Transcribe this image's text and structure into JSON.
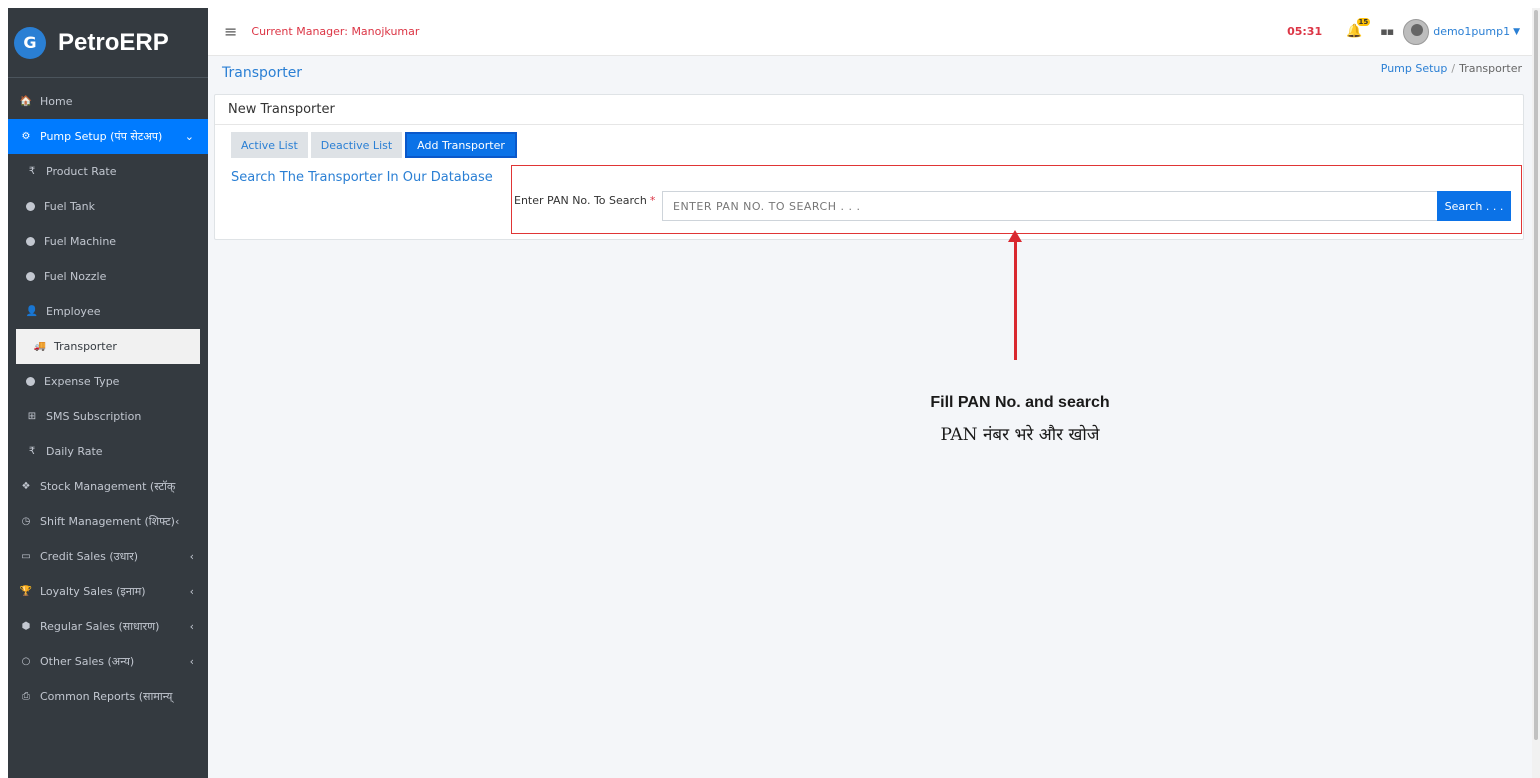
{
  "brand": {
    "name": "PetroERP",
    "logo_letter": "G"
  },
  "sidebar": {
    "items": [
      {
        "icon": "home-icon",
        "glyph": "🏠",
        "label": "Home",
        "type": "main"
      },
      {
        "icon": "cogs-icon",
        "glyph": "⚙",
        "label": "Pump Setup (पंप सेटअप)",
        "type": "main-active",
        "chevron": "⌄"
      },
      {
        "icon": "rupee-icon",
        "glyph": "₹",
        "label": "Product Rate",
        "type": "sub"
      },
      {
        "icon": "circle-icon",
        "label": "Fuel Tank",
        "type": "sub-dot"
      },
      {
        "icon": "circle-icon",
        "label": "Fuel Machine",
        "type": "sub-dot"
      },
      {
        "icon": "circle-icon",
        "label": "Fuel Nozzle",
        "type": "sub-dot"
      },
      {
        "icon": "user-icon",
        "glyph": "👤",
        "label": "Employee",
        "type": "sub"
      },
      {
        "icon": "truck-icon",
        "glyph": "🚚",
        "label": "Transporter",
        "type": "sub-active"
      },
      {
        "icon": "circle-icon",
        "label": "Expense Type",
        "type": "sub-dot"
      },
      {
        "icon": "plus-square-icon",
        "glyph": "⊞",
        "label": "SMS Subscription",
        "type": "sub"
      },
      {
        "icon": "rupee-icon",
        "glyph": "₹",
        "label": "Daily Rate",
        "type": "sub"
      },
      {
        "icon": "cubes-icon",
        "glyph": "❖",
        "label": "Stock Management (स्टॉक्",
        "type": "main"
      },
      {
        "icon": "clock-icon",
        "glyph": "◷",
        "label": "Shift Management (शिफ्ट)‹",
        "type": "main"
      },
      {
        "icon": "credit-card-icon",
        "glyph": "▭",
        "label": "Credit Sales (उधार)",
        "type": "main",
        "chevron": "‹"
      },
      {
        "icon": "trophy-icon",
        "glyph": "🏆",
        "label": "Loyalty Sales (इनाम)",
        "type": "main",
        "chevron": "‹"
      },
      {
        "icon": "cube-icon",
        "glyph": "⬢",
        "label": "Regular Sales (साधारण)",
        "type": "main",
        "chevron": "‹"
      },
      {
        "icon": "circle-outline-icon",
        "glyph": "○",
        "label": "Other Sales (अन्य)",
        "type": "main",
        "chevron": "‹"
      },
      {
        "icon": "print-icon",
        "glyph": "⎙",
        "label": "Common Reports (सामान्य्",
        "type": "main"
      }
    ]
  },
  "topbar": {
    "menu_icon": "≡",
    "manager": "Current Manager: Manojkumar",
    "clock": "05:31",
    "notification_count": "15",
    "username": "demo1pump1"
  },
  "page": {
    "title": "Transporter",
    "breadcrumb": {
      "parent": "Pump Setup",
      "separator": "/",
      "current": "Transporter"
    }
  },
  "card": {
    "header": "New Transporter",
    "tabs": [
      {
        "label": "Active List",
        "active": false
      },
      {
        "label": "Deactive List",
        "active": false
      },
      {
        "label": "Add Transporter",
        "active": true
      }
    ],
    "search_heading": "Search The Transporter In Our Database",
    "pan_label": "Enter PAN No. To Search",
    "required_mark": "*",
    "pan_placeholder": "ENTER PAN NO. TO SEARCH . . .",
    "pan_value": "",
    "search_button": "Search . . ."
  },
  "annotation": {
    "english": "Fill PAN No. and search",
    "hindi": "PAN नंबर भरे और खोजे",
    "color": "#d9282f"
  }
}
